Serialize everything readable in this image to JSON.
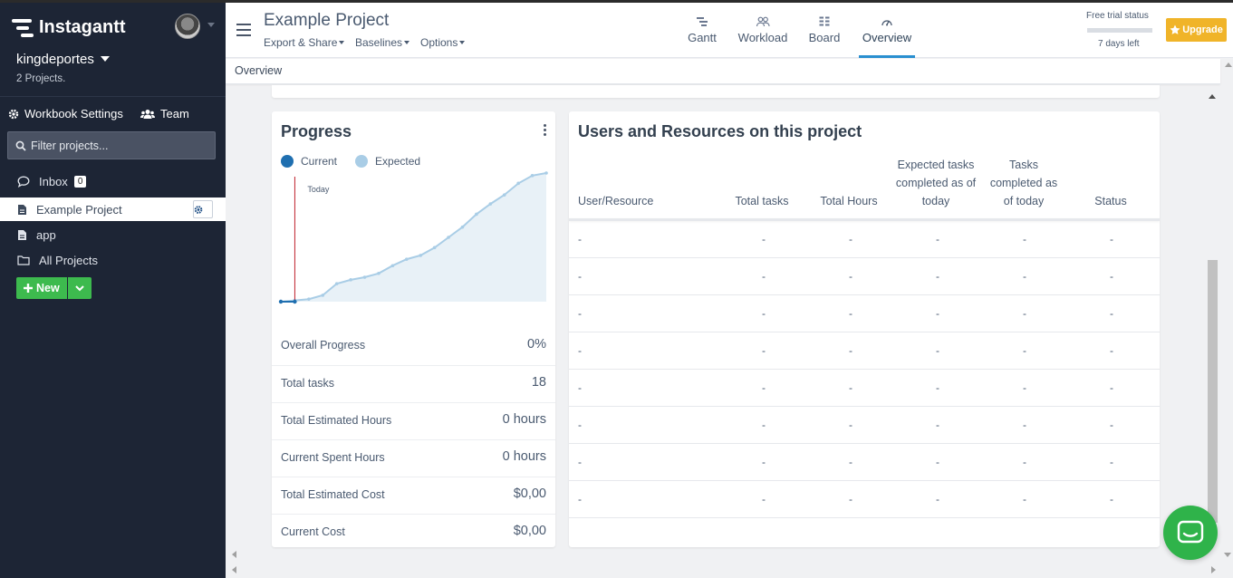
{
  "sidebar": {
    "logo_text": "Instagantt",
    "workspace_name": "kingdeportes",
    "project_count": "2 Projects.",
    "workbook_settings": "Workbook Settings",
    "team": "Team",
    "filter_placeholder": "Filter projects...",
    "items": [
      {
        "label": "Inbox",
        "badge": "0",
        "icon": "chat-icon"
      },
      {
        "label": "Example Project",
        "icon": "document-icon",
        "active": true
      },
      {
        "label": "app",
        "icon": "document-icon"
      },
      {
        "label": "All Projects",
        "icon": "folder-icon"
      }
    ],
    "new_button": "New"
  },
  "header": {
    "project_title": "Example Project",
    "menus": [
      "Export & Share",
      "Baselines",
      "Options"
    ],
    "views": [
      "Gantt",
      "Workload",
      "Board",
      "Overview"
    ],
    "active_view": "Overview",
    "trial_label": "Free trial status",
    "trial_days": "7 days left",
    "upgrade": "Upgrade"
  },
  "breadcrumb": "Overview",
  "progress": {
    "title": "Progress",
    "legend": {
      "current": "Current",
      "expected": "Expected"
    },
    "today_label": "Today",
    "colors": {
      "current": "#1f6fb0",
      "expected": "#a9cde6",
      "today": "#c0202b"
    },
    "stats": [
      {
        "label": "Overall Progress",
        "value": "0%"
      },
      {
        "label": "Total tasks",
        "value": "18"
      },
      {
        "label": "Total Estimated Hours",
        "value": "0 hours"
      },
      {
        "label": "Current Spent Hours",
        "value": "0 hours"
      },
      {
        "label": "Total Estimated Cost",
        "value": "$0,00"
      },
      {
        "label": "Current Cost",
        "value": "$0,00"
      }
    ]
  },
  "chart_data": {
    "type": "area",
    "series": [
      {
        "name": "Expected",
        "values": [
          0,
          1,
          2,
          5,
          14,
          17,
          19,
          22,
          28,
          33,
          36,
          42,
          50,
          58,
          68,
          76,
          83,
          92,
          98,
          100
        ]
      },
      {
        "name": "Current",
        "values": [
          0,
          0
        ]
      }
    ],
    "today_index": 1,
    "ylim": [
      0,
      100
    ]
  },
  "users": {
    "title": "Users and Resources on this project",
    "columns": [
      "User/Resource",
      "Total tasks",
      "Total Hours",
      "Expected tasks completed as of today",
      "Tasks completed as of today",
      "Status"
    ],
    "rows": [
      [
        "-",
        "-",
        "-",
        "-",
        "-",
        "-"
      ],
      [
        "-",
        "-",
        "-",
        "-",
        "-",
        "-"
      ],
      [
        "-",
        "-",
        "-",
        "-",
        "-",
        "-"
      ],
      [
        "-",
        "-",
        "-",
        "-",
        "-",
        "-"
      ],
      [
        "-",
        "-",
        "-",
        "-",
        "-",
        "-"
      ],
      [
        "-",
        "-",
        "-",
        "-",
        "-",
        "-"
      ],
      [
        "-",
        "-",
        "-",
        "-",
        "-",
        "-"
      ],
      [
        "-",
        "-",
        "-",
        "-",
        "-",
        "-"
      ]
    ]
  }
}
